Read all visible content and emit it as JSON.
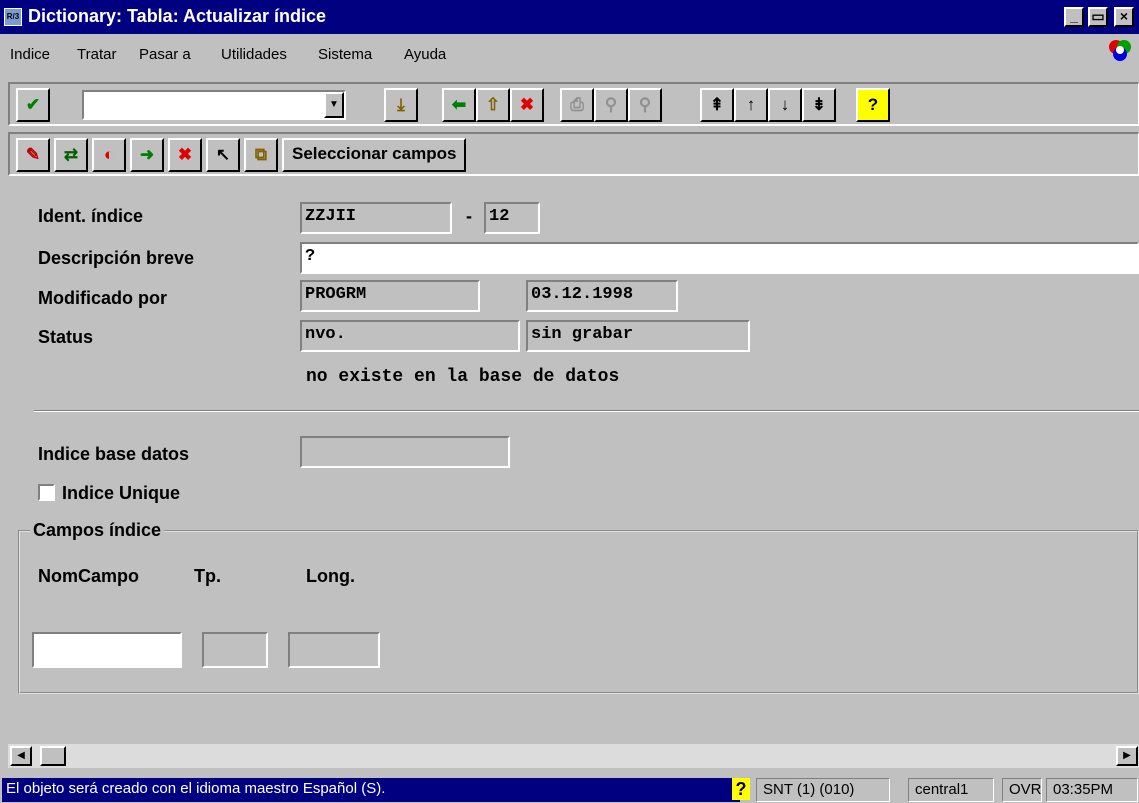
{
  "window": {
    "title": "Dictionary: Tabla: Actualizar índice",
    "icon_text": "R/3",
    "controls": [
      "_",
      "▭",
      "×"
    ]
  },
  "menu": [
    "Indice",
    "Tratar",
    "Pasar a",
    "Utilidades",
    "Sistema",
    "Ayuda"
  ],
  "toolbar1": {
    "command_value": "",
    "icons": [
      "enter-icon",
      "save-icon",
      "back-icon",
      "exit-icon",
      "cancel-icon",
      "print-icon",
      "find-icon",
      "find-next-icon",
      "first-page-icon",
      "previous-page-icon",
      "next-page-icon",
      "last-page-icon",
      "help-icon"
    ]
  },
  "toolbar2": {
    "icons": [
      "display-change-icon",
      "other-index-icon",
      "check-icon",
      "create-icon",
      "delete-icon",
      "pointer-icon",
      "copy-icon"
    ],
    "select_fields_label": "Seleccionar campos"
  },
  "form": {
    "ident_label": "Ident. índice",
    "ident_table": "ZZJII",
    "ident_dash": "-",
    "ident_id": "12",
    "desc_label": "Descripción breve",
    "desc_value": "?",
    "modified_label": "Modificado por",
    "modified_user": "PROGRM",
    "modified_date": "03.12.1998",
    "status_label": "Status",
    "status_value": "nvo.",
    "status_save": "sin grabar",
    "status_note": "no existe en la base de datos",
    "db_index_label": "Indice base datos",
    "db_index_value": "",
    "unique_label": "Indice Unique",
    "unique_checked": false
  },
  "fields_group": {
    "title": "Campos índice",
    "col_name": "NomCampo",
    "col_type": "Tp.",
    "col_length": "Long.",
    "row_name": "",
    "row_type": "",
    "row_length": ""
  },
  "status_bar": {
    "message": "El objeto será creado con el idioma maestro Español (S).",
    "help": "?",
    "system": "SNT (1) (010)",
    "server": "central1",
    "mode": "OVR",
    "time": "03:35PM"
  }
}
